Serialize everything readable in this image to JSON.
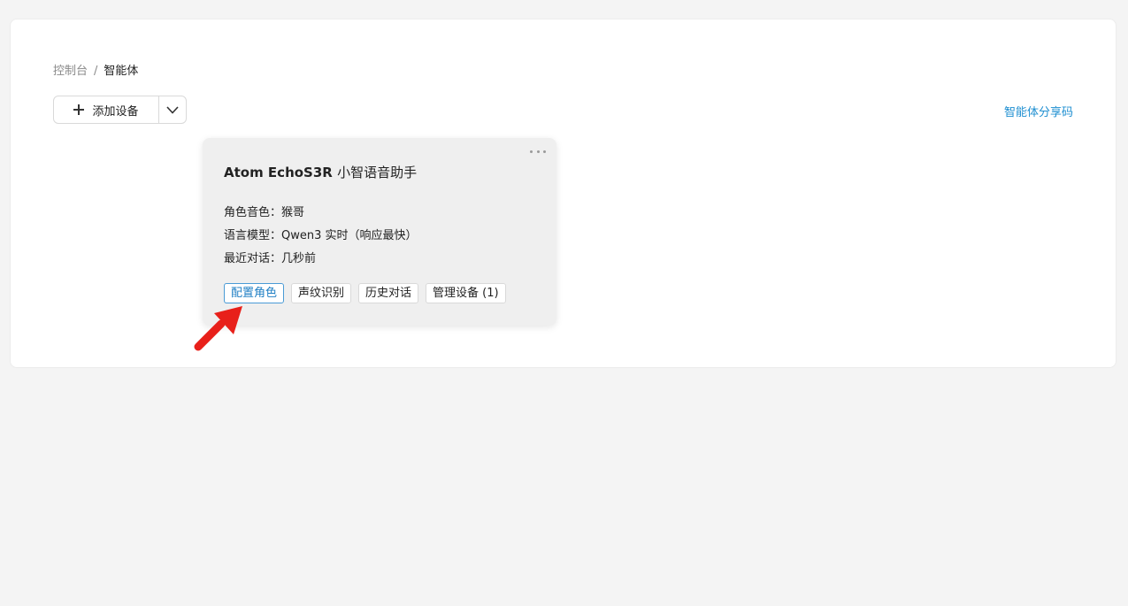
{
  "breadcrumb": {
    "root": "控制台",
    "separator": "/",
    "current": "智能体"
  },
  "toolbar": {
    "add_label": "添加设备",
    "share_label": "智能体分享码"
  },
  "card": {
    "title_main": "Atom EchoS3R",
    "title_sub": "小智语音助手",
    "voice_label": "角色音色：",
    "voice_value": "猴哥",
    "model_label": "语言模型：",
    "model_value": "Qwen3 实时（响应最快）",
    "recent_label": "最近对话：",
    "recent_value": "几秒前",
    "actions": {
      "configure": "配置角色",
      "voiceprint": "声纹识别",
      "history": "历史对话",
      "devices": "管理设备 (1)"
    }
  },
  "colors": {
    "accent": "#1f8fd1",
    "arrow": "#e8201a",
    "background": "#f4f4f4"
  },
  "icons": [
    "plus-icon",
    "chevron-down-icon",
    "more-horizontal-icon",
    "red-arrow-pointer"
  ]
}
